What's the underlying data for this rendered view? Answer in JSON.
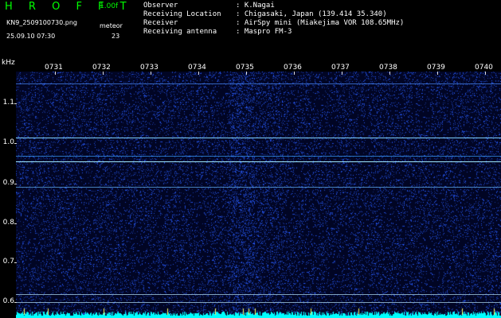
{
  "header": {
    "app_title": "H R O F F T",
    "version": "1.00f",
    "filename": "KN9_2509100730.png",
    "mode": "meteor",
    "timestamp": "25.09.10 07:30",
    "count": "23"
  },
  "info": [
    {
      "key": "Observer",
      "value": ": K.Nagai"
    },
    {
      "key": "Receiving Location",
      "value": ": Chigasaki, Japan (139.414 35.340)"
    },
    {
      "key": "Receiver",
      "value": ": AirSpy mini (Miakejima VOR 108.65MHz)"
    },
    {
      "key": "Receiving antenna",
      "value": ": Maspro FM-3"
    }
  ],
  "axis": {
    "unit": "kHz",
    "y_labels": [
      "1.1",
      "1.0",
      "0.9",
      "0.8",
      "0.7",
      "0.6"
    ],
    "x_labels": [
      "0731",
      "0732",
      "0733",
      "0734",
      "0735",
      "0736",
      "0737",
      "0738",
      "0739",
      "0740"
    ]
  },
  "colors": {
    "title": "#00ff00",
    "background": "#000000",
    "plot": "#010524",
    "noise": "#2a4fff",
    "signal": "#00ffff"
  }
}
